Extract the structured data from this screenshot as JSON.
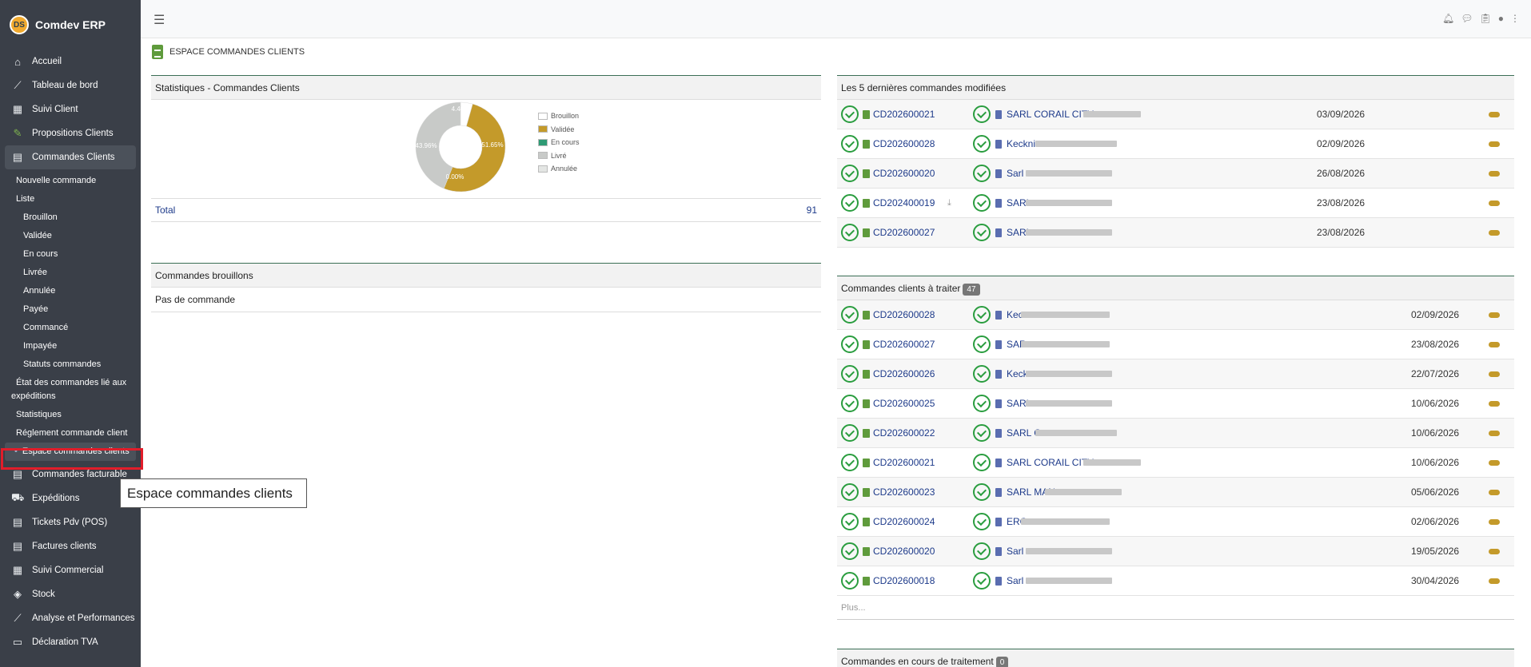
{
  "app": {
    "title": "Comdev ERP",
    "logo_text": "DS"
  },
  "sidebar": {
    "items": [
      {
        "label": "Accueil",
        "icon": "home-icon"
      },
      {
        "label": "Tableau de bord",
        "icon": "chart-line-icon"
      },
      {
        "label": "Suivi Client",
        "icon": "building-icon"
      },
      {
        "label": "Propositions Clients",
        "icon": "pencil-doc-icon"
      },
      {
        "label": "Commandes Clients",
        "icon": "file-icon"
      }
    ],
    "sub": {
      "nouvelle": "Nouvelle commande",
      "liste": "Liste",
      "brouillon": "Brouillon",
      "validee": "Validée",
      "encours": "En cours",
      "livree": "Livrée",
      "annulee": "Annulée",
      "payee": "Payée",
      "commance": "Commancé",
      "impayee": "Impayée",
      "statuts": "Statuts commandes",
      "etat": "État des commandes lié aux expéditions",
      "statistiques": "Statistiques",
      "reglement": "Réglement commande client",
      "espace": "Espace commandes clients"
    },
    "items_after": [
      {
        "label": "Commandes facturable",
        "icon": "file-icon"
      },
      {
        "label": "Expéditions",
        "icon": "dolly-icon"
      },
      {
        "label": "Tickets Pdv (POS)",
        "icon": "ticket-icon"
      },
      {
        "label": "Factures clients",
        "icon": "invoice-icon"
      },
      {
        "label": "Suivi Commercial",
        "icon": "building-icon"
      },
      {
        "label": "Stock",
        "icon": "box-icon"
      },
      {
        "label": "Analyse et Performances",
        "icon": "chart-line-icon"
      },
      {
        "label": "Déclaration TVA",
        "icon": "id-card-icon"
      }
    ]
  },
  "tooltip": "Espace commandes clients",
  "page": {
    "title": "ESPACE COMMANDES CLIENTS"
  },
  "stats": {
    "title": "Statistiques - Commandes Clients",
    "total_label": "Total",
    "total_value": "91",
    "slice_labels": [
      "4.40%",
      "51.65%",
      "0.00%",
      "43.96%"
    ]
  },
  "chart_data": {
    "type": "pie",
    "categories": [
      "Brouillon",
      "Validée",
      "En cours",
      "Livré",
      "Annulée"
    ],
    "values": [
      4.4,
      51.65,
      0.0,
      43.96,
      0.0
    ],
    "colors": [
      "#ffffff",
      "#c49a2a",
      "#2e9a74",
      "#c8cac8",
      "#e4e6e4"
    ],
    "legend": "right"
  },
  "drafts": {
    "title": "Commandes brouillons",
    "empty": "Pas de commande"
  },
  "last5": {
    "title": "Les 5 dernières commandes modifiées",
    "rows": [
      {
        "ref": "CD202600021",
        "cust": "SARL CORAIL CITY",
        "date": "03/09/2026"
      },
      {
        "ref": "CD202600028",
        "cust": "Keckni",
        "date": "02/09/2026"
      },
      {
        "ref": "CD202600020",
        "cust": "Sarl",
        "date": "26/08/2026"
      },
      {
        "ref": "CD202400019",
        "cust": "SARL",
        "date": "23/08/2026"
      },
      {
        "ref": "CD202600027",
        "cust": "SARL",
        "date": "23/08/2026"
      }
    ]
  },
  "totreat": {
    "title": "Commandes clients à traiter",
    "badge": "47",
    "more": "Plus...",
    "rows": [
      {
        "ref": "CD202600028",
        "cust": "Kec",
        "date": "02/09/2026"
      },
      {
        "ref": "CD202600027",
        "cust": "SAR",
        "date": "23/08/2026"
      },
      {
        "ref": "CD202600026",
        "cust": "Keck",
        "date": "22/07/2026"
      },
      {
        "ref": "CD202600025",
        "cust": "SARL",
        "date": "10/06/2026"
      },
      {
        "ref": "CD202600022",
        "cust": "SARL C",
        "date": "10/06/2026"
      },
      {
        "ref": "CD202600021",
        "cust": "SARL CORAIL CITY",
        "date": "10/06/2026"
      },
      {
        "ref": "CD202600023",
        "cust": "SARL MAN",
        "date": "05/06/2026"
      },
      {
        "ref": "CD202600024",
        "cust": "ERG",
        "date": "02/06/2026"
      },
      {
        "ref": "CD202600020",
        "cust": "Sarl",
        "date": "19/05/2026"
      },
      {
        "ref": "CD202600018",
        "cust": "Sarl",
        "date": "30/04/2026"
      }
    ]
  },
  "inprog": {
    "title": "Commandes en cours de traitement",
    "badge": "0"
  }
}
